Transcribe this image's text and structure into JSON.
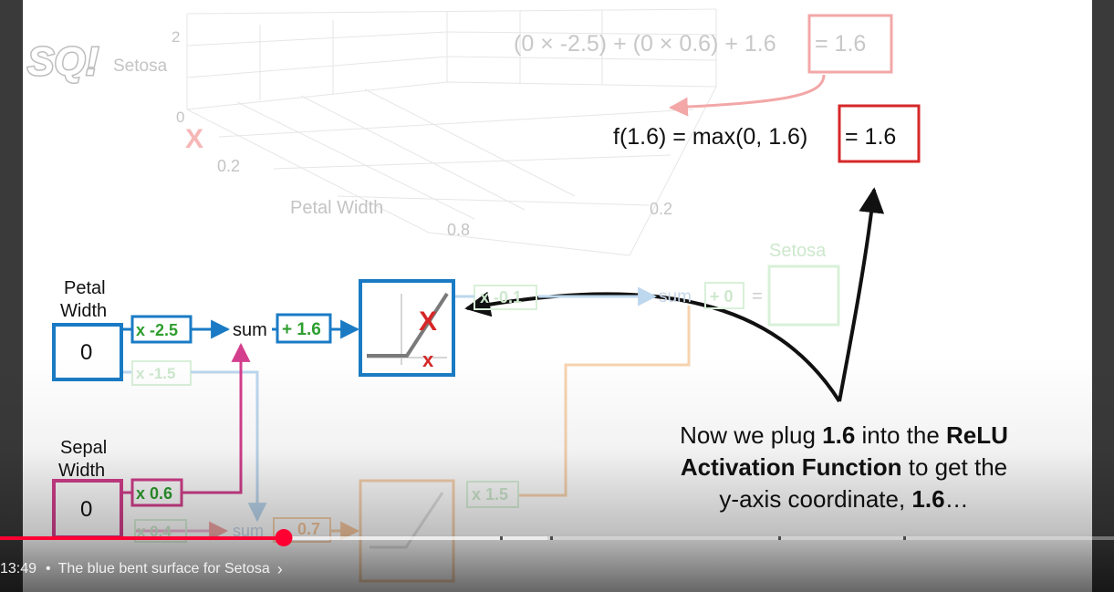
{
  "player": {
    "time_current": "13:49",
    "separator": "•",
    "chapter_title": "The blue bent surface for Setosa",
    "chevron": "›",
    "progress_fraction": 0.255
  },
  "logo": {
    "text": "SQ!",
    "icon": "statquest-logo"
  },
  "plot3d": {
    "z_tick_top": "2",
    "z_tick_bottom": "0",
    "setosa_label": "Setosa",
    "x_tick_a": "0.2",
    "x_tick_b": "0.8",
    "y_tick": "0.2",
    "axis_label": "Petal Width",
    "marker": "X"
  },
  "equation_top": "(0 × -2.5) + (0 × 0.6) + 1.6 = 1.6",
  "equation_top_left": "(0 × -2.5) + (0 × 0.6) + 1.6",
  "equation_top_box": "= 1.6",
  "relu_eq_left": "f(1.6) = max(0, 1.6)",
  "relu_eq_box": "= 1.6",
  "network": {
    "petal_label_1": "Petal",
    "petal_label_2": "Width",
    "petal_value": "0",
    "sepal_label_1": "Sepal",
    "sepal_label_2": "Width",
    "sepal_value": "0",
    "w_petal_top": "x -2.5",
    "w_petal_bottom": "x -1.5",
    "w_sepal_top": "x 0.6",
    "w_sepal_bottom": "x 0.4",
    "sum_label": "sum",
    "bias_top": "+ 1.6",
    "bias_bottom": "0.7",
    "w_out_top": "x -0.1",
    "w_out_bottom": "x 1.5",
    "out_sum": "sum",
    "out_bias": "+ 0",
    "out_eq": "=",
    "out_label": "Setosa",
    "relu_marker_big": "X",
    "relu_marker_small": "x"
  },
  "caption": {
    "line1_pre": "Now we plug ",
    "line1_bold": "1.6",
    "line1_mid": " into the ",
    "line1_bold2": "ReLU",
    "line2_bold": "Activation Function",
    "line2_post": " to get the",
    "line3_pre": "y-axis coordinate, ",
    "line3_bold": "1.6",
    "line3_post": "…"
  },
  "colors": {
    "blue": "#1a7bc4",
    "pink": "#d43f8d",
    "green": "#2e9e2e",
    "red": "#d62728",
    "orange": "#f2a654",
    "faint": "#cfcfcf",
    "progress": "#ff0033"
  }
}
